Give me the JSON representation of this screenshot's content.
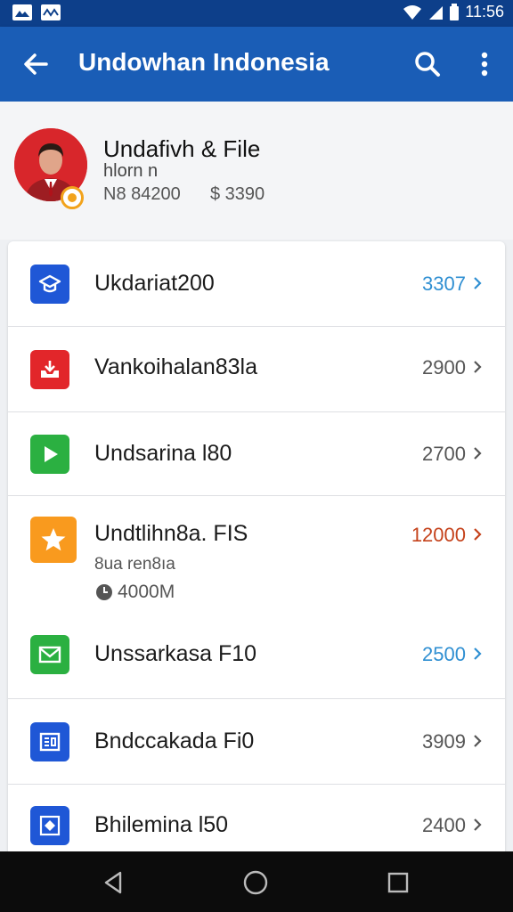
{
  "status_bar": {
    "time": "11:56",
    "left_icons": [
      "gallery-icon",
      "activity-icon"
    ],
    "right_icons": [
      "wifi-icon",
      "signal-icon",
      "battery-icon"
    ]
  },
  "app_bar": {
    "title": "Undowhan Indonesia",
    "icons": [
      "back-arrow-icon",
      "search-icon",
      "more-vert-icon"
    ]
  },
  "profile": {
    "name": "Undafivh & File",
    "subtitle": "hlorn n",
    "stat_1": "N8 84200",
    "stat_2": "$ 3390",
    "badge_color": "#f2a31c"
  },
  "list": {
    "items": [
      {
        "label": "Ukdariat200",
        "value": "3307",
        "value_color": "#2f8fd2",
        "icon": "school-icon",
        "icon_color": "#1f57d6"
      },
      {
        "label": "Vankoihalan83la",
        "value": "2900",
        "value_color": "#555555",
        "icon": "download-tray-icon",
        "icon_color": "#e2262a"
      },
      {
        "label": "Undsarina l80",
        "value": "2700",
        "value_color": "#555555",
        "icon": "play-icon",
        "icon_color": "#2bb041"
      },
      {
        "label": "Undtlihn8a. FIS",
        "value": "12000",
        "value_color": "#c5421b",
        "icon": "star-icon",
        "icon_color": "#f99a1e",
        "sub": "8ua ren8ıa",
        "sub2": "4000M"
      },
      {
        "label": "Unssarkasa F10",
        "value": "2500",
        "value_color": "#2f8fd2",
        "icon": "mail-icon",
        "icon_color": "#2bb041"
      },
      {
        "label": "Bndccakada Fi0",
        "value": "3909",
        "value_color": "#555555",
        "icon": "document-icon",
        "icon_color": "#1f57d6"
      },
      {
        "label": "Bhilemina l50",
        "value": "2400",
        "value_color": "#555555",
        "icon": "diamond-icon",
        "icon_color": "#1f57d6"
      }
    ]
  },
  "nav_bar": {
    "icons": [
      "back-triangle-icon",
      "home-circle-icon",
      "recents-square-icon"
    ]
  }
}
